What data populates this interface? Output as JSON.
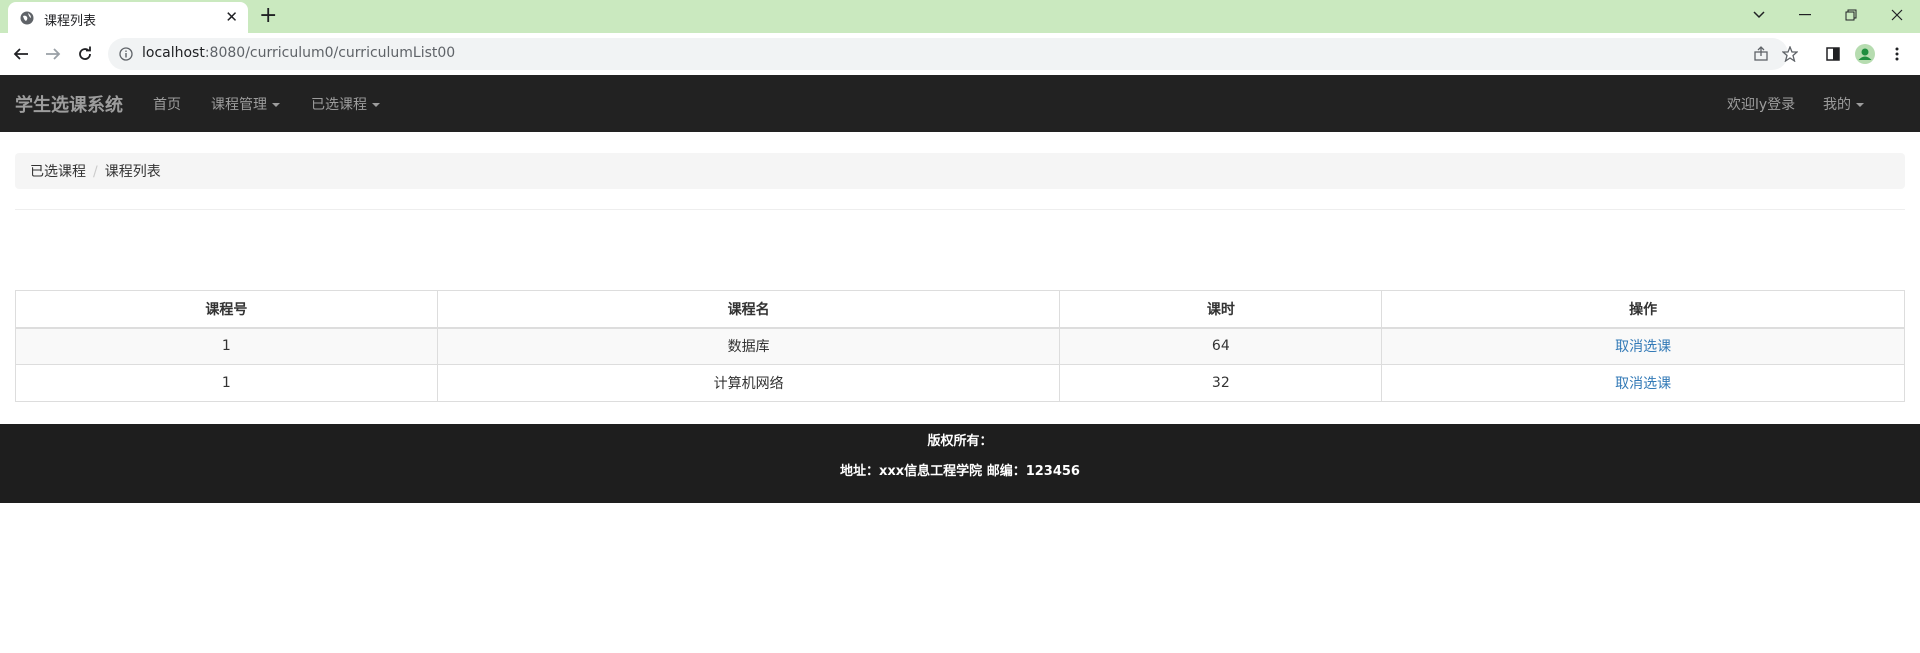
{
  "browser": {
    "tab_title": "课程列表",
    "url_host": "localhost",
    "url_path": ":8080/curriculum0/curriculumList00"
  },
  "navbar": {
    "brand": "学生选课系统",
    "links": [
      "首页",
      "课程管理",
      "已选课程"
    ],
    "welcome": "欢迎ly登录",
    "mine": "我的"
  },
  "breadcrumb": {
    "items": [
      "已选课程",
      "课程列表"
    ],
    "separator": "/"
  },
  "table": {
    "headers": [
      "课程号",
      "课程名",
      "课时",
      "操作"
    ],
    "rows": [
      {
        "id": "1",
        "name": "数据库",
        "hours": "64",
        "action": "取消选课"
      },
      {
        "id": "1",
        "name": "计算机网络",
        "hours": "32",
        "action": "取消选课"
      }
    ]
  },
  "footer": {
    "copyright": "版权所有：",
    "address": "地址：xxx信息工程学院 邮编：123456"
  },
  "colors": {
    "tabbar_bg": "#cae9bf",
    "navbar_bg": "#222222",
    "footer_bg": "#1e1e1e",
    "link": "#337ab7"
  }
}
